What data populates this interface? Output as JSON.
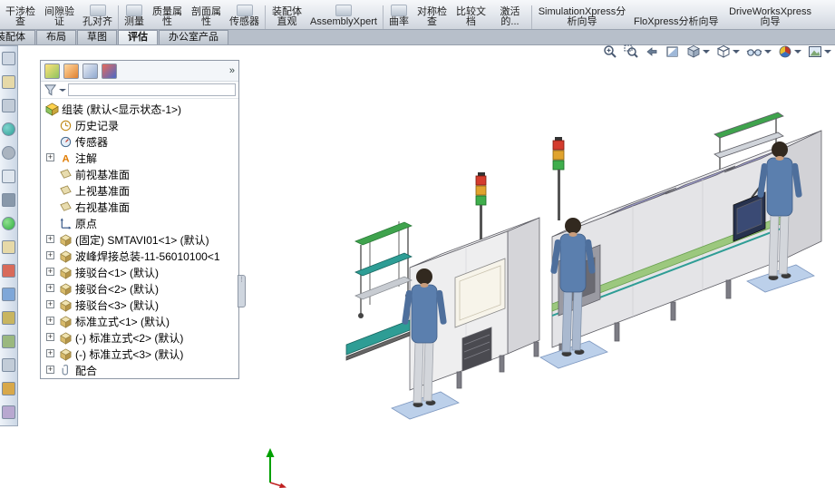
{
  "ribbon": {
    "buttons": [
      {
        "label": "干涉检查"
      },
      {
        "label": "间隙验证"
      },
      {
        "label": "孔对齐"
      },
      {
        "label": "测量"
      },
      {
        "label": "质量属性"
      },
      {
        "label": "剖面属性"
      },
      {
        "label": "传感器"
      },
      {
        "label": "装配体直观"
      },
      {
        "label": "AssemblyXpert"
      },
      {
        "label": "曲率"
      },
      {
        "label": "对称检查"
      },
      {
        "label": "比较文档"
      },
      {
        "label": "激活的..."
      },
      {
        "label": "SimulationXpress分析向导"
      },
      {
        "label": "FloXpress分析向导"
      },
      {
        "label": "DriveWorksXpress向导"
      }
    ]
  },
  "tabs": {
    "items": [
      {
        "label": "装配体",
        "active": false
      },
      {
        "label": "布局",
        "active": false
      },
      {
        "label": "草图",
        "active": false
      },
      {
        "label": "评估",
        "active": true
      },
      {
        "label": "办公室产品",
        "active": false
      }
    ]
  },
  "view_toolbar": {
    "icons": [
      "zoom-fit",
      "zoom-area",
      "previous-view",
      "section-view",
      "view-orientation",
      "display-style",
      "hide-show-items",
      "edit-appearance",
      "apply-scene"
    ]
  },
  "leftbar": {
    "icons": [
      "wrench-icon",
      "ruler-icon",
      "pushpin-icon",
      "sphere-icon",
      "gear-icon",
      "snowflake-icon",
      "funnel-icon",
      "green-ball-icon",
      "measure-icon",
      "crosshair-icon",
      "eye-icon",
      "lock-icon",
      "image-icon",
      "arrow-down-icon",
      "pencil-icon",
      "palette-icon"
    ]
  },
  "panel": {
    "tabs": [
      "featuremanager",
      "propertymanager",
      "configurationmanager",
      "displaymanager"
    ],
    "chevron": "»",
    "filter": {
      "value": "",
      "placeholder": ""
    },
    "tree": {
      "root": "组装  (默认<显示状态-1>)",
      "items": [
        {
          "label": "历史记录",
          "icon": "history-icon",
          "expandable": false
        },
        {
          "label": "传感器",
          "icon": "sensors-icon",
          "expandable": false
        },
        {
          "label": "注解",
          "icon": "annotations-icon",
          "expandable": true
        },
        {
          "label": "前视基准面",
          "icon": "plane-icon",
          "expandable": false
        },
        {
          "label": "上视基准面",
          "icon": "plane-icon",
          "expandable": false
        },
        {
          "label": "右视基准面",
          "icon": "plane-icon",
          "expandable": false
        },
        {
          "label": "原点",
          "icon": "origin-icon",
          "expandable": false
        },
        {
          "label": "(固定) SMTAVI01<1> (默认)",
          "icon": "component-icon",
          "expandable": true
        },
        {
          "label": "波峰焊接总装-11-56010100<1",
          "icon": "component-icon",
          "expandable": true
        },
        {
          "label": "接驳台<1> (默认)",
          "icon": "component-icon",
          "expandable": true
        },
        {
          "label": "接驳台<2> (默认)",
          "icon": "component-icon",
          "expandable": true
        },
        {
          "label": "接驳台<3> (默认)",
          "icon": "component-icon",
          "expandable": true
        },
        {
          "label": "标准立式<1> (默认)",
          "icon": "component-icon",
          "expandable": true
        },
        {
          "label": "(-) 标准立式<2> (默认)",
          "icon": "component-icon",
          "expandable": true
        },
        {
          "label": "(-) 标准立式<3> (默认)",
          "icon": "component-icon",
          "expandable": true
        },
        {
          "label": "配合",
          "icon": "mates-icon",
          "expandable": true
        }
      ]
    }
  },
  "colors": {
    "accent_teal": "#2e9d95",
    "window_purple": "#9b99cc",
    "shirt_blue": "#5b7fae",
    "mat_blue": "#bcd0ea",
    "signal_red": "#d43c2e",
    "signal_yellow": "#e0a32e",
    "signal_green": "#3fae4c"
  }
}
